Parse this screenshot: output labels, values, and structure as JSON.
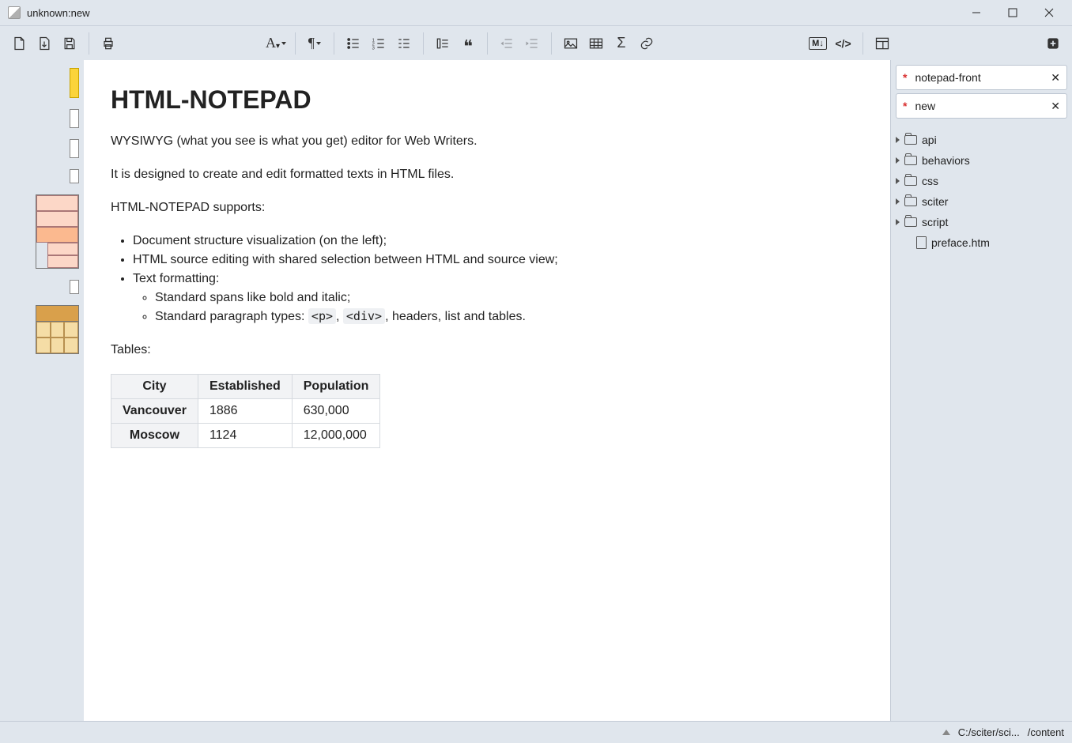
{
  "window": {
    "title": "unknown:new"
  },
  "toolbar_icons": {
    "new": "new-file",
    "open": "open-file",
    "save": "save",
    "print": "print",
    "font": "A",
    "pilcrow": "¶",
    "ul": "ul",
    "ol": "ol",
    "dl": "dl",
    "indent": "indent",
    "quote": "“",
    "dedent_l": "dedent-left",
    "dedent_r": "dedent-right",
    "image": "image",
    "table": "table",
    "sigma": "Σ",
    "link": "link",
    "markdown": "M↓",
    "source": "</>",
    "layout": "layout",
    "add": "+"
  },
  "document": {
    "heading": "HTML-NOTEPAD",
    "p1": "WYSIWYG (what you see is what you get) editor for Web Writers.",
    "p2": "It is designed to create and edit formatted texts in HTML files.",
    "p3": "HTML-NOTEPAD supports:",
    "bullets": [
      "Document structure visualization (on the left);",
      "HTML source editing with shared selection between HTML and source view;",
      "Text formatting:"
    ],
    "sub_bullets": [
      "Standard spans like bold and italic;",
      "Standard paragraph types:"
    ],
    "sub_tail": ", headers, list and tables.",
    "code1": "<p>",
    "code2": "<div>",
    "p4": "Tables:",
    "table": {
      "headers": [
        "City",
        "Established",
        "Population"
      ],
      "rows": [
        [
          "Vancouver",
          "1886",
          "630,000"
        ],
        [
          "Moscow",
          "1124",
          "12,000,000"
        ]
      ]
    }
  },
  "tabs": [
    {
      "modified": true,
      "label": "notepad-front"
    },
    {
      "modified": true,
      "label": "new"
    }
  ],
  "tree": {
    "folders": [
      "api",
      "behaviors",
      "css",
      "sciter",
      "script"
    ],
    "files": [
      "preface.htm"
    ]
  },
  "status": {
    "path1": "C:/sciter/sci...",
    "path2": "/content"
  }
}
